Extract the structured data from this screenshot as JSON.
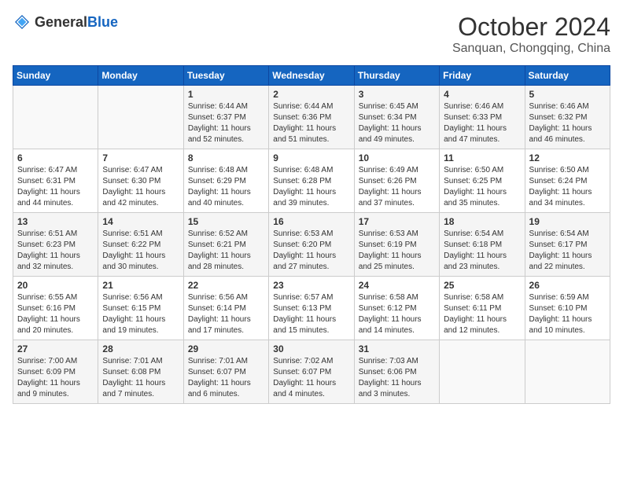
{
  "header": {
    "logo": {
      "general": "General",
      "blue": "Blue"
    },
    "title": "October 2024",
    "location": "Sanquan, Chongqing, China"
  },
  "weekdays": [
    "Sunday",
    "Monday",
    "Tuesday",
    "Wednesday",
    "Thursday",
    "Friday",
    "Saturday"
  ],
  "weeks": [
    [
      {
        "day": "",
        "sunrise": "",
        "sunset": "",
        "daylight": ""
      },
      {
        "day": "",
        "sunrise": "",
        "sunset": "",
        "daylight": ""
      },
      {
        "day": "1",
        "sunrise": "Sunrise: 6:44 AM",
        "sunset": "Sunset: 6:37 PM",
        "daylight": "Daylight: 11 hours and 52 minutes."
      },
      {
        "day": "2",
        "sunrise": "Sunrise: 6:44 AM",
        "sunset": "Sunset: 6:36 PM",
        "daylight": "Daylight: 11 hours and 51 minutes."
      },
      {
        "day": "3",
        "sunrise": "Sunrise: 6:45 AM",
        "sunset": "Sunset: 6:34 PM",
        "daylight": "Daylight: 11 hours and 49 minutes."
      },
      {
        "day": "4",
        "sunrise": "Sunrise: 6:46 AM",
        "sunset": "Sunset: 6:33 PM",
        "daylight": "Daylight: 11 hours and 47 minutes."
      },
      {
        "day": "5",
        "sunrise": "Sunrise: 6:46 AM",
        "sunset": "Sunset: 6:32 PM",
        "daylight": "Daylight: 11 hours and 46 minutes."
      }
    ],
    [
      {
        "day": "6",
        "sunrise": "Sunrise: 6:47 AM",
        "sunset": "Sunset: 6:31 PM",
        "daylight": "Daylight: 11 hours and 44 minutes."
      },
      {
        "day": "7",
        "sunrise": "Sunrise: 6:47 AM",
        "sunset": "Sunset: 6:30 PM",
        "daylight": "Daylight: 11 hours and 42 minutes."
      },
      {
        "day": "8",
        "sunrise": "Sunrise: 6:48 AM",
        "sunset": "Sunset: 6:29 PM",
        "daylight": "Daylight: 11 hours and 40 minutes."
      },
      {
        "day": "9",
        "sunrise": "Sunrise: 6:48 AM",
        "sunset": "Sunset: 6:28 PM",
        "daylight": "Daylight: 11 hours and 39 minutes."
      },
      {
        "day": "10",
        "sunrise": "Sunrise: 6:49 AM",
        "sunset": "Sunset: 6:26 PM",
        "daylight": "Daylight: 11 hours and 37 minutes."
      },
      {
        "day": "11",
        "sunrise": "Sunrise: 6:50 AM",
        "sunset": "Sunset: 6:25 PM",
        "daylight": "Daylight: 11 hours and 35 minutes."
      },
      {
        "day": "12",
        "sunrise": "Sunrise: 6:50 AM",
        "sunset": "Sunset: 6:24 PM",
        "daylight": "Daylight: 11 hours and 34 minutes."
      }
    ],
    [
      {
        "day": "13",
        "sunrise": "Sunrise: 6:51 AM",
        "sunset": "Sunset: 6:23 PM",
        "daylight": "Daylight: 11 hours and 32 minutes."
      },
      {
        "day": "14",
        "sunrise": "Sunrise: 6:51 AM",
        "sunset": "Sunset: 6:22 PM",
        "daylight": "Daylight: 11 hours and 30 minutes."
      },
      {
        "day": "15",
        "sunrise": "Sunrise: 6:52 AM",
        "sunset": "Sunset: 6:21 PM",
        "daylight": "Daylight: 11 hours and 28 minutes."
      },
      {
        "day": "16",
        "sunrise": "Sunrise: 6:53 AM",
        "sunset": "Sunset: 6:20 PM",
        "daylight": "Daylight: 11 hours and 27 minutes."
      },
      {
        "day": "17",
        "sunrise": "Sunrise: 6:53 AM",
        "sunset": "Sunset: 6:19 PM",
        "daylight": "Daylight: 11 hours and 25 minutes."
      },
      {
        "day": "18",
        "sunrise": "Sunrise: 6:54 AM",
        "sunset": "Sunset: 6:18 PM",
        "daylight": "Daylight: 11 hours and 23 minutes."
      },
      {
        "day": "19",
        "sunrise": "Sunrise: 6:54 AM",
        "sunset": "Sunset: 6:17 PM",
        "daylight": "Daylight: 11 hours and 22 minutes."
      }
    ],
    [
      {
        "day": "20",
        "sunrise": "Sunrise: 6:55 AM",
        "sunset": "Sunset: 6:16 PM",
        "daylight": "Daylight: 11 hours and 20 minutes."
      },
      {
        "day": "21",
        "sunrise": "Sunrise: 6:56 AM",
        "sunset": "Sunset: 6:15 PM",
        "daylight": "Daylight: 11 hours and 19 minutes."
      },
      {
        "day": "22",
        "sunrise": "Sunrise: 6:56 AM",
        "sunset": "Sunset: 6:14 PM",
        "daylight": "Daylight: 11 hours and 17 minutes."
      },
      {
        "day": "23",
        "sunrise": "Sunrise: 6:57 AM",
        "sunset": "Sunset: 6:13 PM",
        "daylight": "Daylight: 11 hours and 15 minutes."
      },
      {
        "day": "24",
        "sunrise": "Sunrise: 6:58 AM",
        "sunset": "Sunset: 6:12 PM",
        "daylight": "Daylight: 11 hours and 14 minutes."
      },
      {
        "day": "25",
        "sunrise": "Sunrise: 6:58 AM",
        "sunset": "Sunset: 6:11 PM",
        "daylight": "Daylight: 11 hours and 12 minutes."
      },
      {
        "day": "26",
        "sunrise": "Sunrise: 6:59 AM",
        "sunset": "Sunset: 6:10 PM",
        "daylight": "Daylight: 11 hours and 10 minutes."
      }
    ],
    [
      {
        "day": "27",
        "sunrise": "Sunrise: 7:00 AM",
        "sunset": "Sunset: 6:09 PM",
        "daylight": "Daylight: 11 hours and 9 minutes."
      },
      {
        "day": "28",
        "sunrise": "Sunrise: 7:01 AM",
        "sunset": "Sunset: 6:08 PM",
        "daylight": "Daylight: 11 hours and 7 minutes."
      },
      {
        "day": "29",
        "sunrise": "Sunrise: 7:01 AM",
        "sunset": "Sunset: 6:07 PM",
        "daylight": "Daylight: 11 hours and 6 minutes."
      },
      {
        "day": "30",
        "sunrise": "Sunrise: 7:02 AM",
        "sunset": "Sunset: 6:07 PM",
        "daylight": "Daylight: 11 hours and 4 minutes."
      },
      {
        "day": "31",
        "sunrise": "Sunrise: 7:03 AM",
        "sunset": "Sunset: 6:06 PM",
        "daylight": "Daylight: 11 hours and 3 minutes."
      },
      {
        "day": "",
        "sunrise": "",
        "sunset": "",
        "daylight": ""
      },
      {
        "day": "",
        "sunrise": "",
        "sunset": "",
        "daylight": ""
      }
    ]
  ]
}
